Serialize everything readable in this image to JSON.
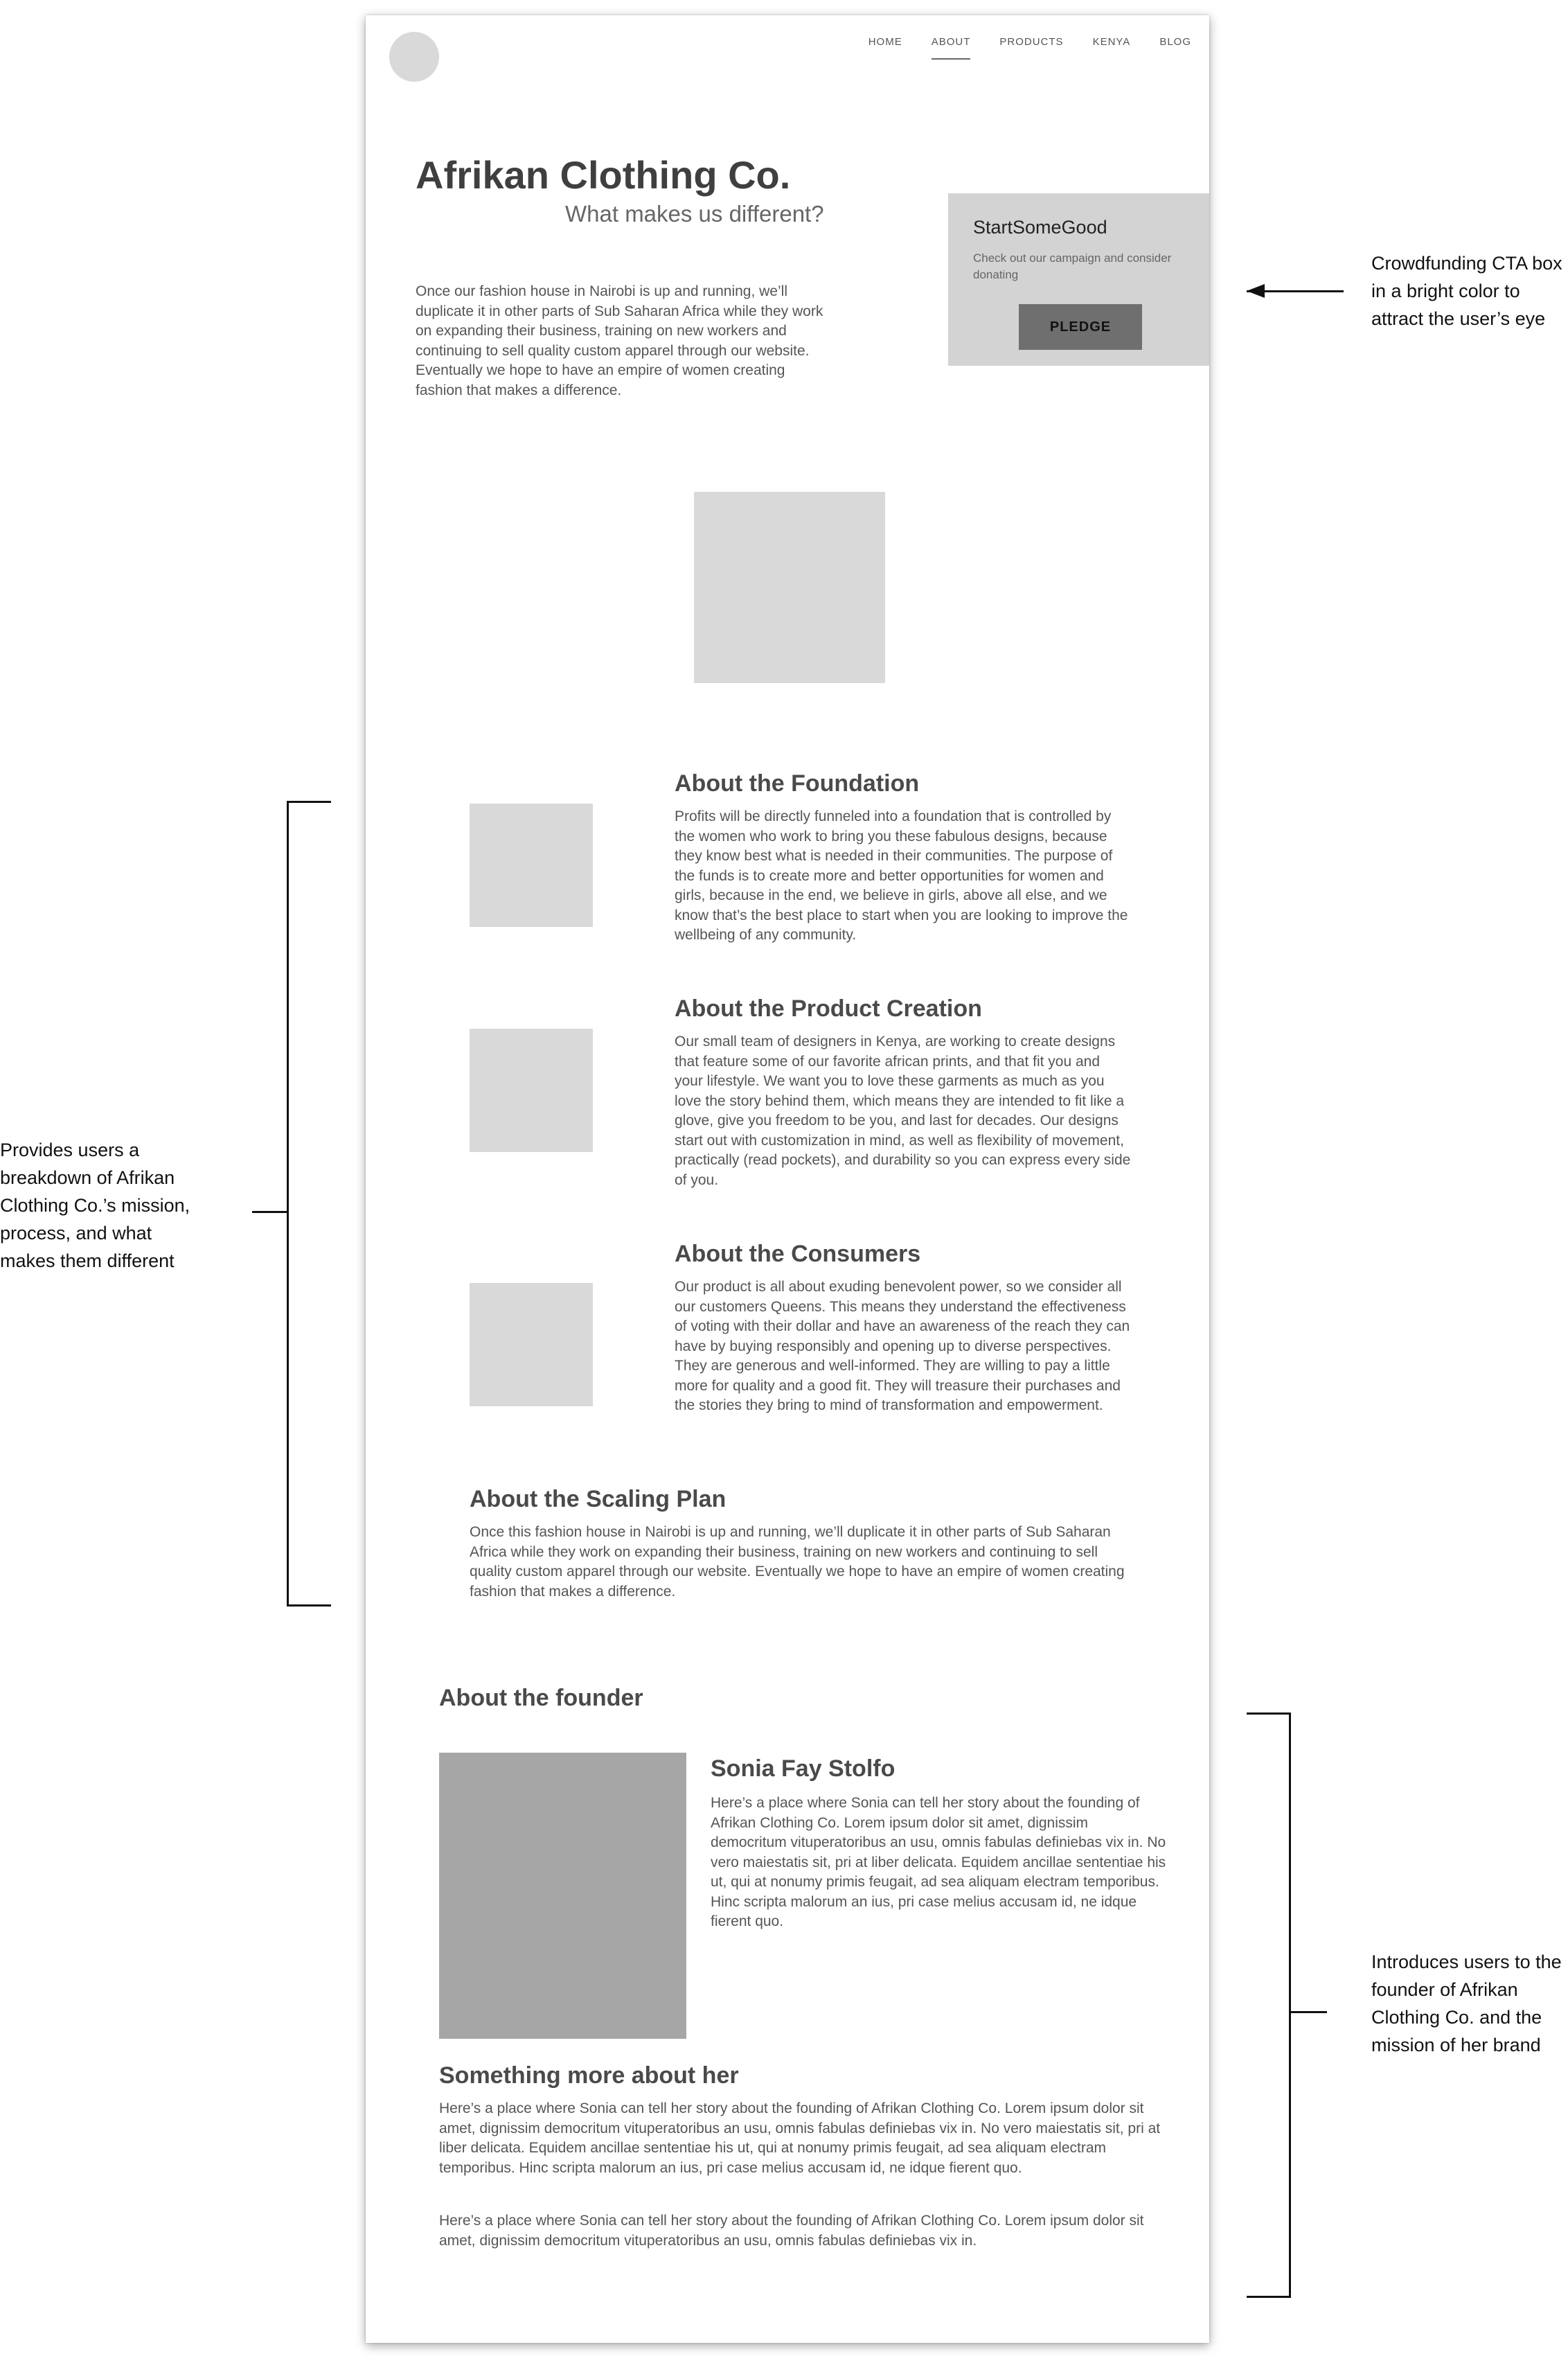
{
  "nav": {
    "items": [
      "HOME",
      "ABOUT",
      "PRODUCTS",
      "KENYA",
      "BLOG"
    ],
    "active": "ABOUT"
  },
  "hero": {
    "title": "Afrikan Clothing Co.",
    "subtitle": "What makes us different?",
    "body": "Once our fashion house in Nairobi is up and running, we’ll duplicate it in other parts of Sub Saharan Africa while they work on expanding their business, training on new workers and continuing to sell quality custom apparel through our website. Eventually we hope to have an empire of women creating fashion that makes a difference."
  },
  "cta": {
    "title": "StartSomeGood",
    "text": "Check out our campaign and consider donating",
    "button": "PLEDGE"
  },
  "sections": [
    {
      "title": "About the Foundation",
      "body": "Profits will be directly funneled into a foundation that is controlled by the women who work to bring you these fabulous designs, because they know best what is needed in their communities. The purpose of the funds is to create more and better opportunities for women and girls, because in the end, we believe in girls, above all else, and we know that’s the best place to start when you are looking to improve the wellbeing of any community."
    },
    {
      "title": "About the Product Creation",
      "body": "Our small team of designers in Kenya, are working to create designs that feature some of our favorite african prints, and that fit you and your lifestyle. We want you to love these garments as much as you love the story behind them, which means they are intended to fit like a glove, give you freedom to be you, and last for decades. Our designs start out with customization in mind, as well as flexibility of movement, practically (read pockets), and durability so you can express every side of you."
    },
    {
      "title": "About the Consumers",
      "body": "Our product is all about exuding benevolent power, so we consider all our customers Queens. This means they understand the effectiveness of voting with their dollar and have an awareness of the reach they can have by buying responsibly and opening up to diverse perspectives. They are generous and well-informed. They are willing to pay a little more for quality and a good fit. They will treasure their purchases and the stories they bring to mind of transformation and empowerment."
    }
  ],
  "scaling": {
    "title": "About the Scaling Plan",
    "body": "Once this fashion house in Nairobi is up and running, we’ll duplicate it in other parts of Sub Saharan Africa while they work on expanding their business, training on new workers and continuing to sell quality custom apparel through our website. Eventually we hope to have an empire of women creating fashion that makes a difference."
  },
  "founder": {
    "heading": "About the founder",
    "name": "Sonia Fay Stolfo",
    "bio": "Here’s a place where Sonia can tell her story about the founding of Afrikan Clothing Co. Lorem ipsum dolor sit amet, dignissim democritum vituperatoribus an usu, omnis fabulas definiebas vix in. No vero maiestatis sit, pri at liber delicata. Equidem ancillae sententiae his ut, qui at nonumy primis feugait, ad sea aliquam electram temporibus. Hinc scripta malorum an ius, pri case melius accusam id, ne idque fierent quo.",
    "more_title": "Something more about her",
    "more_body_1": "Here’s a place where Sonia can tell her story about the founding of Afrikan Clothing Co. Lorem ipsum dolor sit amet, dignissim democritum vituperatoribus an usu, omnis fabulas definiebas vix in. No vero maiestatis sit, pri at liber delicata. Equidem ancillae sententiae his ut, qui at nonumy primis feugait, ad sea aliquam electram temporibus. Hinc scripta malorum an ius, pri case melius accusam id, ne idque fierent quo.",
    "more_body_2": "Here’s a place where Sonia can tell her story about the founding of Afrikan Clothing Co. Lorem ipsum dolor sit amet, dignissim democritum vituperatoribus an usu, omnis fabulas definiebas vix in."
  },
  "annotations": {
    "cta_note": "Crowdfunding CTA box in a bright color to attract the user’s eye",
    "sections_note": "Provides users a breakdown of Afrikan Clothing Co.’s mission, process, and what makes them different",
    "founder_note": "Introduces users to the founder of Afrikan Clothing Co. and the mission of her brand"
  },
  "colors": {
    "placeholder": "#d9d9d9",
    "cta_bg": "#d3d3d3",
    "cta_button": "#6f6f6f",
    "founder_photo": "#a6a6a6"
  }
}
